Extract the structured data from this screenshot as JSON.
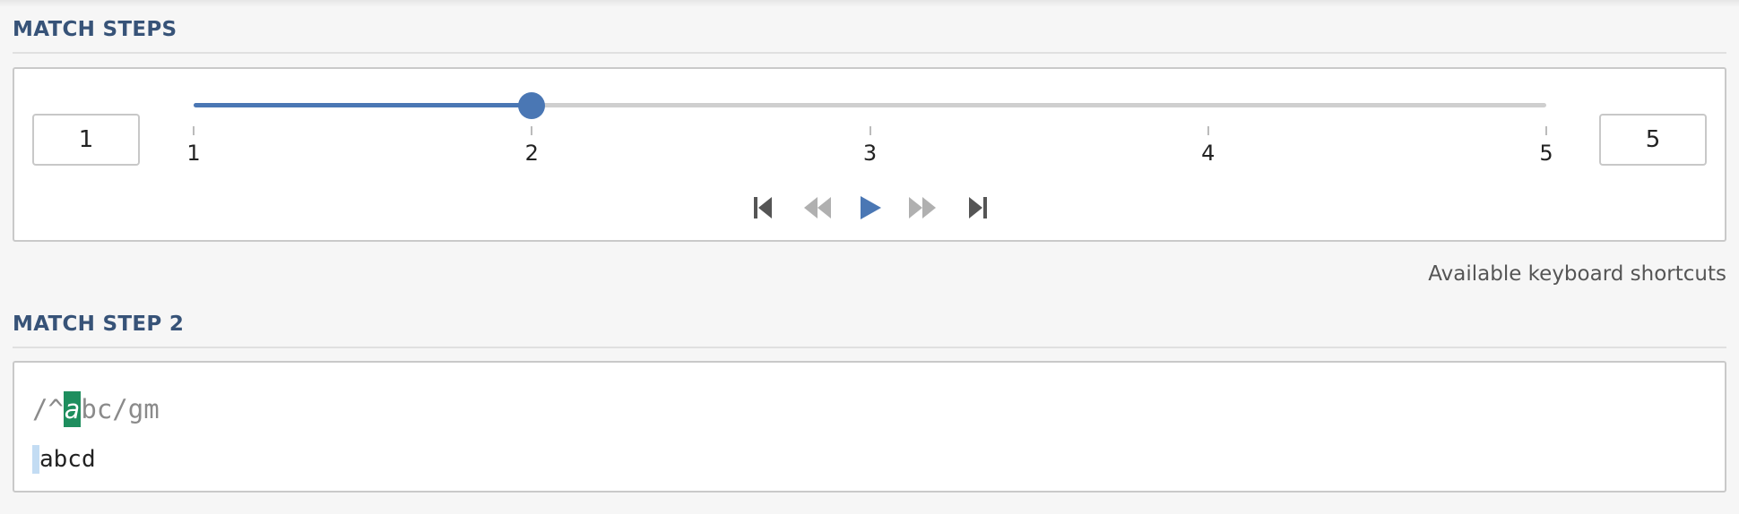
{
  "match_steps": {
    "title": "MATCH STEPS",
    "min_value": "1",
    "max_value": "5",
    "slider": {
      "min": 1,
      "max": 5,
      "current": 2,
      "ticks": [
        "1",
        "2",
        "3",
        "4",
        "5"
      ]
    },
    "controls": [
      {
        "name": "first-step-icon",
        "enabled": true
      },
      {
        "name": "previous-step-icon",
        "enabled": false
      },
      {
        "name": "play-icon",
        "enabled": true
      },
      {
        "name": "next-step-icon",
        "enabled": false
      },
      {
        "name": "last-step-icon",
        "enabled": true
      }
    ]
  },
  "shortcuts_link": "Available keyboard shortcuts",
  "match_step": {
    "title": "MATCH STEP 2",
    "regex_before": "/^",
    "regex_highlight": "a",
    "regex_after": "bc/gm",
    "subject": "abcd"
  },
  "colors": {
    "accent": "#4a77b4",
    "title": "#375378",
    "highlight": "#1e8e5e",
    "cursor": "#c3dcf3"
  }
}
